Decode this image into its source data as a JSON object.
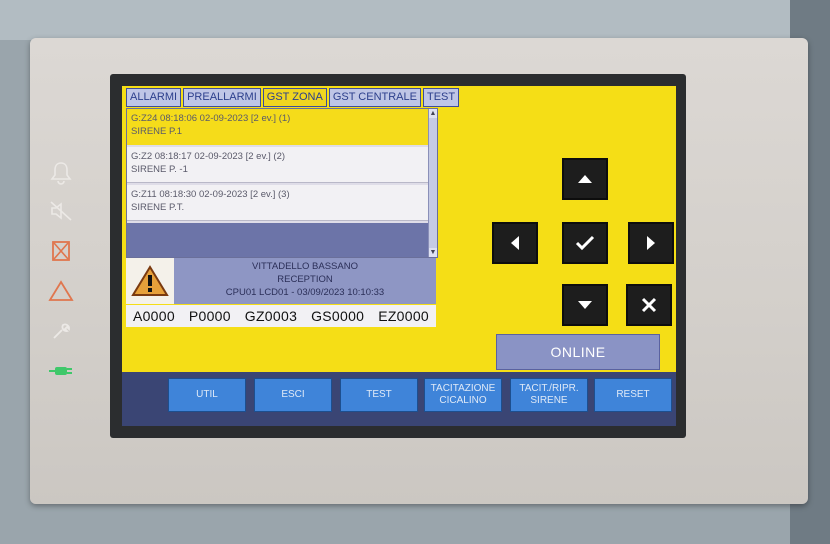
{
  "tabs": [
    {
      "label": "ALLARMI",
      "active": false
    },
    {
      "label": "PREALLARMI",
      "active": false
    },
    {
      "label": "GST ZONA",
      "active": true
    },
    {
      "label": "GST CENTRALE",
      "active": false
    },
    {
      "label": "TEST",
      "active": false
    }
  ],
  "events": [
    {
      "line1": "G:Z24 08:18:06 02-09-2023 [2 ev.] (1)",
      "line2": "SIRENE P.1",
      "selected": true
    },
    {
      "line1": "G:Z2 08:18:17 02-09-2023 [2 ev.] (2)",
      "line2": "SIRENE P. -1",
      "selected": false
    },
    {
      "line1": "G:Z11 08:18:30 02-09-2023 [2 ev.] (3)",
      "line2": "SIRENE P.T.",
      "selected": false
    }
  ],
  "info": {
    "site": "VITTADELLO BASSANO",
    "location": "RECEPTION",
    "status": "CPU01 LCD01 - 03/09/2023 10:10:33"
  },
  "counters": {
    "a": "A0000",
    "p": "P0000",
    "gz": "GZ0003",
    "gs": "GS0000",
    "ez": "EZ0000"
  },
  "online_label": "ONLINE",
  "buttons": {
    "util": "UTIL",
    "esci": "ESCI",
    "test": "TEST",
    "tacitazione": "TACITAZIONE CICALINO",
    "tacit_ripr": "TACIT./RIPR. SIRENE",
    "reset": "RESET"
  },
  "side_icons": [
    "bell-icon",
    "speaker-muted-icon",
    "fault-cross-icon",
    "warning-triangle-icon",
    "wrench-icon",
    "power-plug-icon"
  ],
  "colors": {
    "screen_bg": "#f5de16",
    "button_blue": "#3f84d9",
    "alarm_led": "#e0764e",
    "power_led": "#3fc86a"
  }
}
